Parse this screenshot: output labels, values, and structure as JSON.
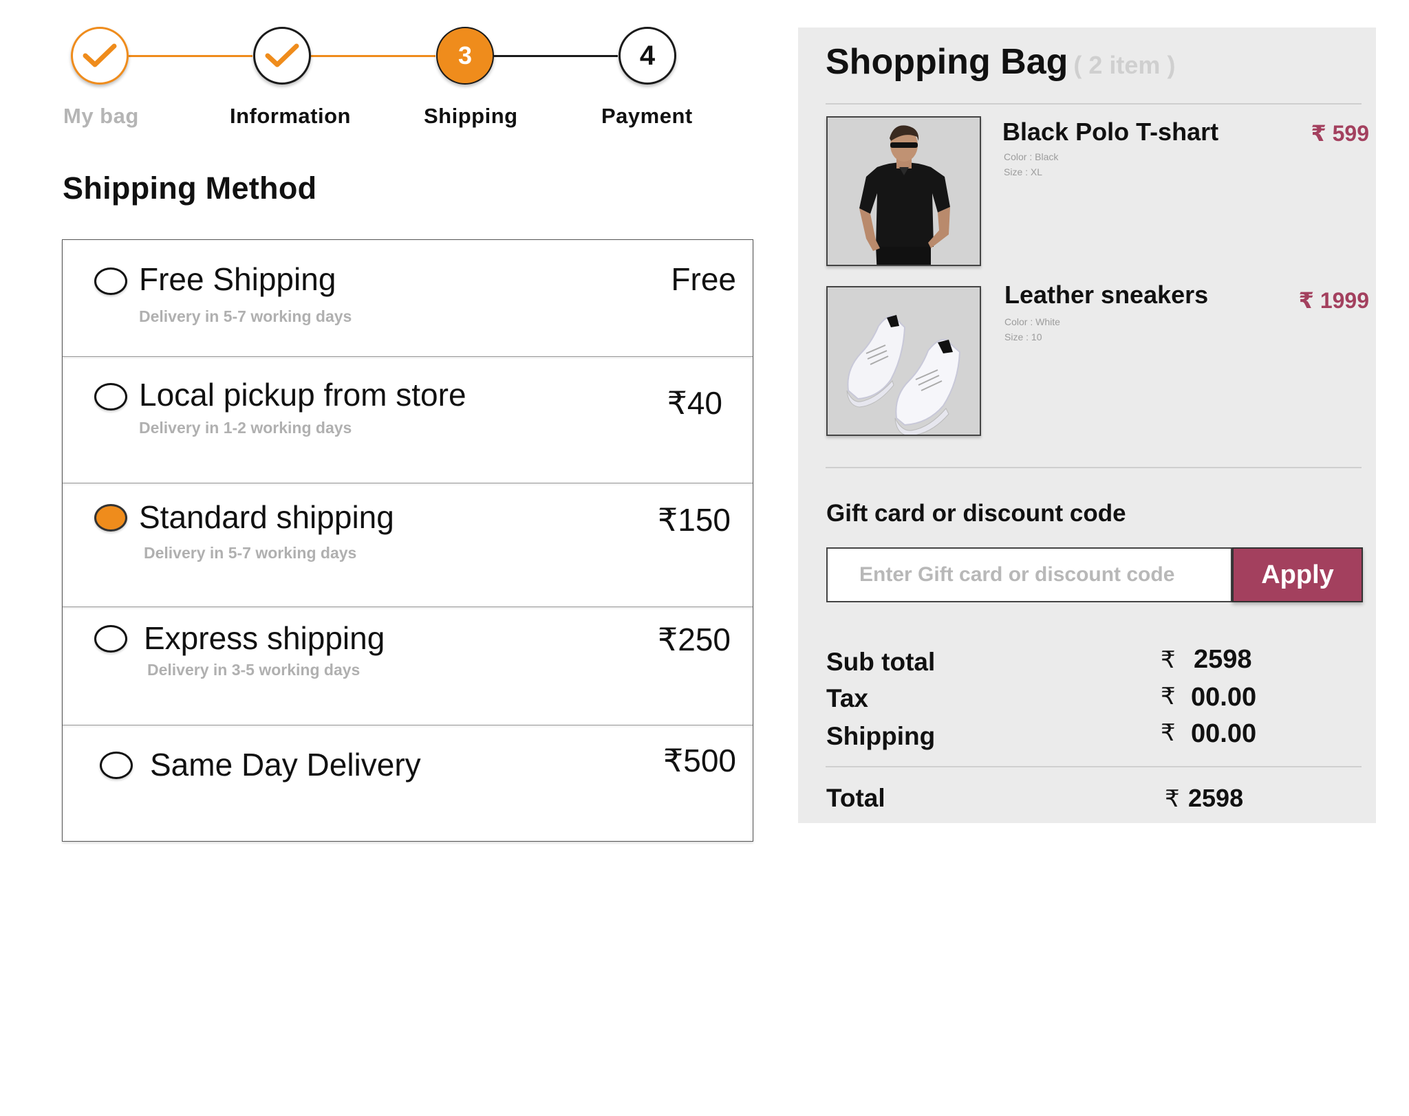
{
  "stepper": {
    "steps": [
      {
        "label": "My bag",
        "state": "done"
      },
      {
        "label": "Information",
        "state": "done"
      },
      {
        "label": "Shipping",
        "number": "3",
        "state": "current"
      },
      {
        "label": "Payment",
        "number": "4",
        "state": "todo"
      }
    ]
  },
  "shipping": {
    "title": "Shipping Method",
    "options": [
      {
        "name": "Free Shipping",
        "desc": "Delivery in 5-7 working days",
        "price": "Free",
        "selected": false
      },
      {
        "name": "Local pickup from store",
        "desc": "Delivery in 1-2 working days",
        "price": "₹40",
        "selected": false
      },
      {
        "name": "Standard shipping",
        "desc": "Delivery in 5-7 working days",
        "price": "₹150",
        "selected": true
      },
      {
        "name": "Express shipping",
        "desc": "Delivery in 3-5 working days",
        "price": "₹250",
        "selected": false
      },
      {
        "name": "Same Day Delivery",
        "desc": "",
        "price": "₹500",
        "selected": false
      }
    ]
  },
  "bag": {
    "title": "Shopping Bag",
    "count": "( 2 item )",
    "items": [
      {
        "name": "Black Polo T-shart",
        "color": "Color : Black",
        "size": "Size : XL",
        "price": "₹ 599"
      },
      {
        "name": "Leather sneakers",
        "color": "Color : White",
        "size": "Size : 10",
        "price": "₹ 1999"
      }
    ],
    "gift": {
      "label": "Gift card or discount code",
      "placeholder": "Enter Gift card or discount code",
      "apply": "Apply"
    },
    "summary": {
      "currency": "₹",
      "subtotal_label": "Sub total",
      "subtotal": "2598",
      "tax_label": "Tax",
      "tax": "00.00",
      "shipping_label": "Shipping",
      "shipping": "00.00",
      "total_label": "Total",
      "total": "2598"
    }
  },
  "colors": {
    "accent": "#ef8c1c",
    "brand": "#a3405e",
    "panel": "#ebebeb"
  }
}
